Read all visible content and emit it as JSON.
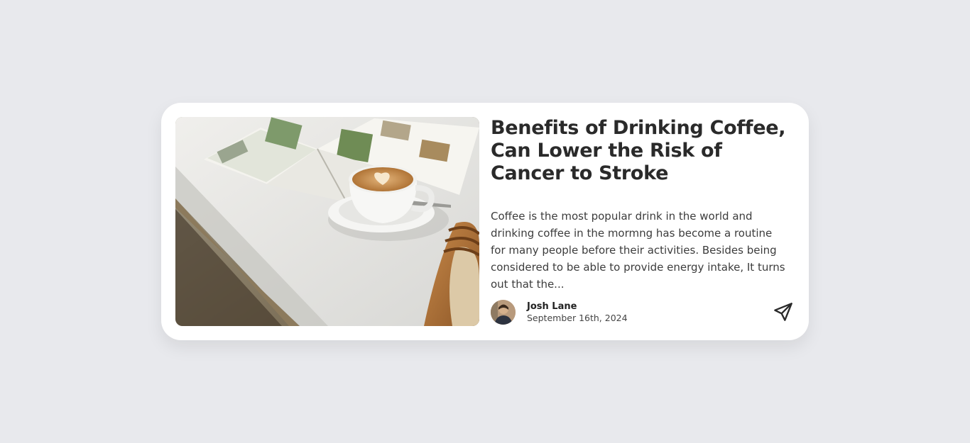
{
  "article": {
    "title": "Benefits of Drinking Coffee, Can Lower the Risk of Cancer to Stroke",
    "excerpt": "Coffee is the most popular drink in the world and drinking coffee in the mormng has become a routine for many people before their activities. Besides being considered to be able to provide energy intake, It turns out that the...",
    "image_icon": "coffee-photo",
    "author": {
      "name": "Josh Lane",
      "date": "September 16th, 2024",
      "avatar_icon": "avatar-photo"
    },
    "share_icon": "send-icon"
  },
  "colors": {
    "page_background": "#e8e9ed",
    "card_background": "#ffffff",
    "title_text": "#2a2a2a",
    "body_text": "#3c3c3c"
  }
}
